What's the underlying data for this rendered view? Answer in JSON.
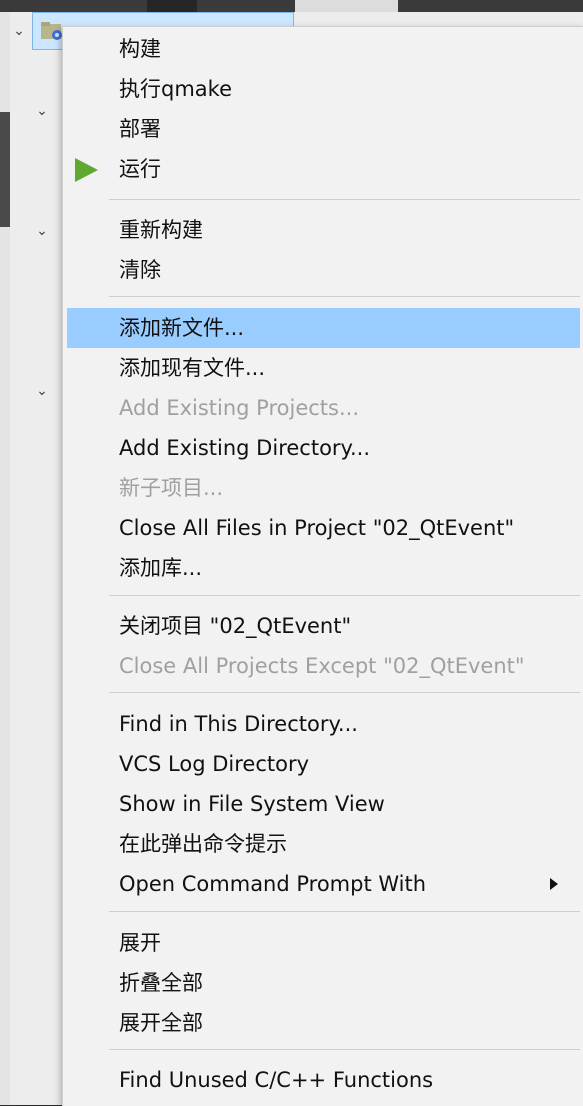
{
  "menu": {
    "items": [
      {
        "label": "构建",
        "enabled": true
      },
      {
        "label": "执行qmake",
        "enabled": true
      },
      {
        "label": "部署",
        "enabled": true
      },
      {
        "label": "运行",
        "enabled": true,
        "icon": "play-icon"
      },
      {
        "label": "重新构建",
        "enabled": true
      },
      {
        "label": "清除",
        "enabled": true
      },
      {
        "label": "添加新文件...",
        "enabled": true,
        "highlighted": true
      },
      {
        "label": "添加现有文件...",
        "enabled": true
      },
      {
        "label": "Add Existing Projects...",
        "enabled": false
      },
      {
        "label": "Add Existing Directory...",
        "enabled": true
      },
      {
        "label": "新子项目...",
        "enabled": false
      },
      {
        "label": "Close All Files in Project \"02_QtEvent\"",
        "enabled": true
      },
      {
        "label": "添加库...",
        "enabled": true
      },
      {
        "label": "关闭项目 \"02_QtEvent\"",
        "enabled": true
      },
      {
        "label": "Close All Projects Except \"02_QtEvent\"",
        "enabled": false
      },
      {
        "label": "Find in This Directory...",
        "enabled": true
      },
      {
        "label": "VCS Log Directory",
        "enabled": true
      },
      {
        "label": "Show in File System View",
        "enabled": true
      },
      {
        "label": "在此弹出命令提示",
        "enabled": true
      },
      {
        "label": "Open Command Prompt With",
        "enabled": true,
        "submenu": true
      },
      {
        "label": "展开",
        "enabled": true
      },
      {
        "label": "折叠全部",
        "enabled": true
      },
      {
        "label": "展开全部",
        "enabled": true
      },
      {
        "label": "Find Unused C/C++ Functions",
        "enabled": true
      }
    ]
  },
  "colors": {
    "highlight": "#99ccff",
    "disabled_text": "#a0a0a0",
    "run_icon": "#5fa832",
    "menu_bg": "#f2f2f2"
  }
}
